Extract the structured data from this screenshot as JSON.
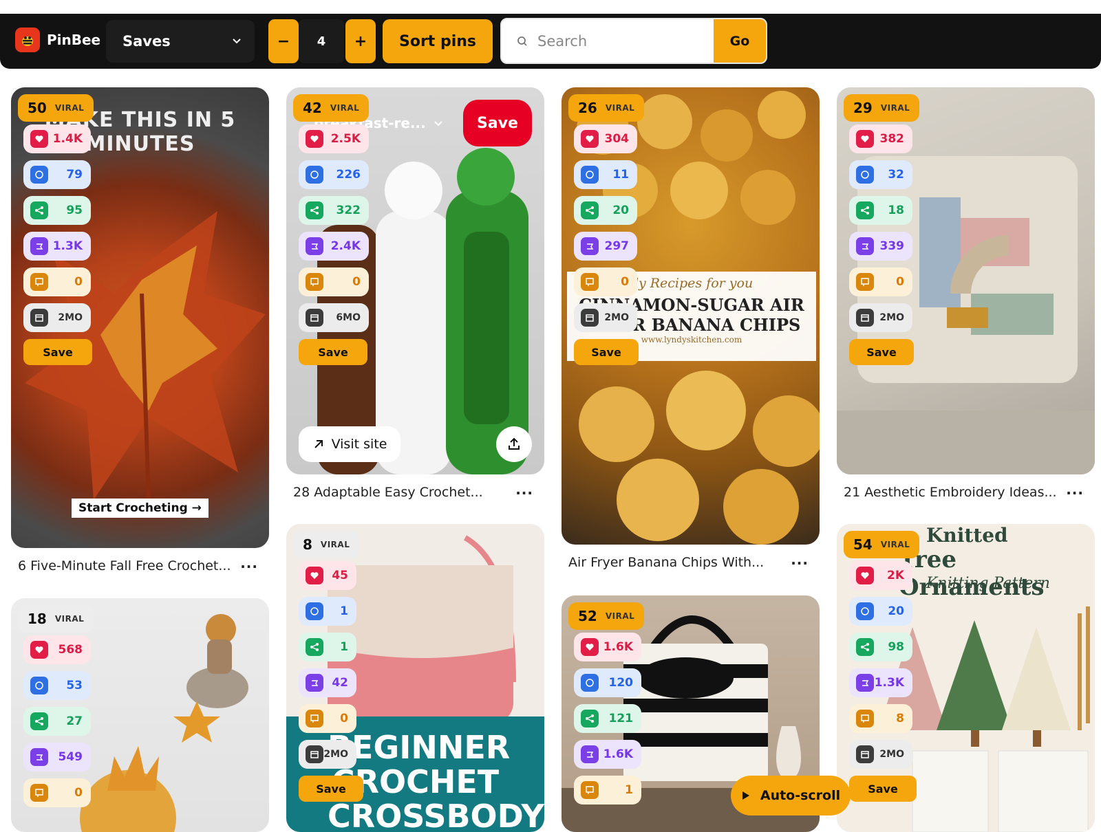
{
  "header": {
    "brand": "PinBee",
    "board_select": "Saves",
    "step_minus": "−",
    "step_value": "4",
    "step_plus": "+",
    "sort_label": "Sort pins",
    "search_placeholder": "Search",
    "go_label": "Go"
  },
  "common": {
    "viral": "VIRAL",
    "save": "Save",
    "more": "...",
    "visit": "Visit site"
  },
  "pins": [
    {
      "rank": "50",
      "likes": "1.4K",
      "comments": "79",
      "shares": "95",
      "saves": "1.3K",
      "notes": "0",
      "age": "2MO",
      "title": "6 Five-Minute Fall Free Crochet...",
      "overlay_top": "MAKE THIS IN 5 MINUTES",
      "overlay_cta": "Start Crocheting →"
    },
    {
      "rank": "42",
      "likes": "2.5K",
      "comments": "226",
      "shares": "322",
      "saves": "2.4K",
      "notes": "0",
      "age": "6MO",
      "title": "28 Adaptable Easy Crochet...",
      "board": "breakfast-re...",
      "save_red": "Save"
    },
    {
      "rank": "26",
      "likes": "304",
      "comments": "11",
      "shares": "20",
      "saves": "297",
      "notes": "0",
      "age": "2MO",
      "title": "Air Fryer Banana Chips With...",
      "overlay_l1": "ily Recipes for you",
      "overlay_l2": "CINNAMON-SUGAR AIR",
      "overlay_l3": "FRYER BANANA CHIPS",
      "overlay_l4": "www.lyndyskitchen.com"
    },
    {
      "rank": "29",
      "likes": "382",
      "comments": "32",
      "shares": "18",
      "saves": "339",
      "notes": "0",
      "age": "2MO",
      "title": "21 Aesthetic Embroidery Ideas..."
    },
    {
      "rank": "18",
      "likes": "568",
      "comments": "53",
      "shares": "27",
      "saves": "549",
      "notes": "0"
    },
    {
      "rank": "8",
      "likes": "45",
      "comments": "1",
      "shares": "1",
      "saves": "42",
      "notes": "0",
      "age": "2MO",
      "overlay_text": "BEGINNER CROCHET CROSSBODY"
    },
    {
      "rank": "52",
      "likes": "1.6K",
      "comments": "120",
      "shares": "121",
      "saves": "1.6K",
      "notes": "1"
    },
    {
      "rank": "54",
      "likes": "2K",
      "comments": "20",
      "shares": "98",
      "saves": "1.3K",
      "notes": "8",
      "age": "2MO",
      "overlay_l1": "Knitted",
      "overlay_l2": "Tree Ornaments",
      "overlay_l3": "Knitting Pattern"
    }
  ],
  "autoscroll_label": "Auto-scroll",
  "colors": {
    "accent": "#f5a60c",
    "topbar": "#121212",
    "pinterest_red": "#e60023"
  }
}
